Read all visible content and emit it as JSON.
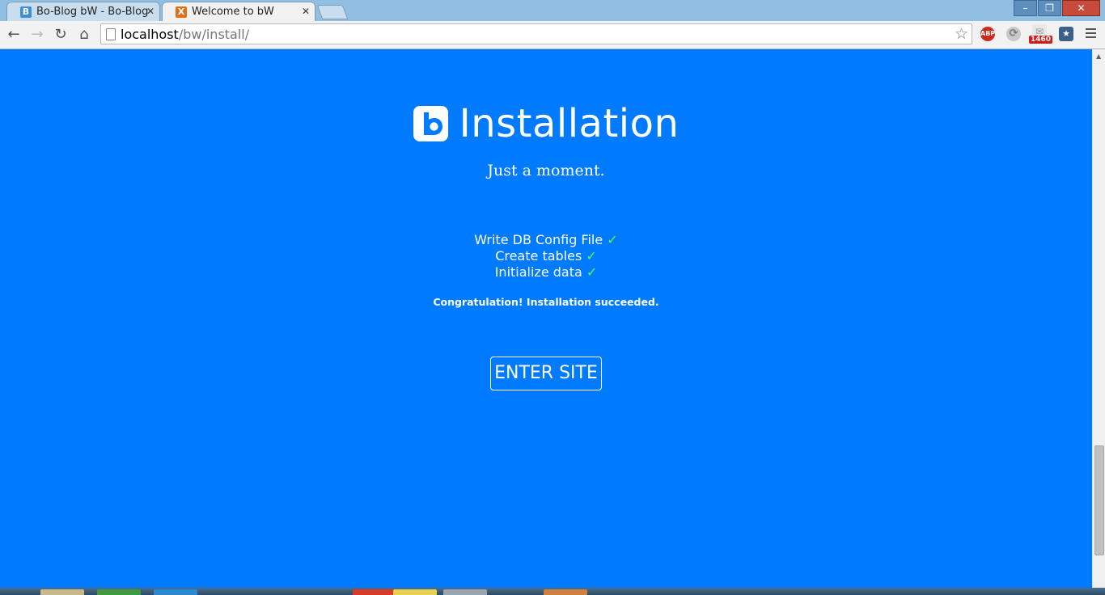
{
  "browser": {
    "tabs": [
      {
        "title": "Bo-Blog bW - Bo-Blog",
        "favicon": "B",
        "favicon_color": "#3a8fd8"
      },
      {
        "title": "Welcome to bW",
        "favicon": "X",
        "favicon_color": "#e0701e"
      }
    ],
    "address": {
      "host": "localhost",
      "path": "/bw/install/"
    },
    "extension_badge": "1460",
    "abp_label": "ABP"
  },
  "page": {
    "title": "Installation",
    "subtitle": "Just a moment.",
    "steps": [
      {
        "label": "Write DB Config File",
        "status": "✓"
      },
      {
        "label": "Create tables",
        "status": "✓"
      },
      {
        "label": "Initialize data",
        "status": "✓"
      }
    ],
    "message": "Congratulation! Installation succeeded.",
    "enter_button": "ENTER SITE"
  },
  "colors": {
    "page_background": "#007bff",
    "check": "#4cff4c"
  }
}
